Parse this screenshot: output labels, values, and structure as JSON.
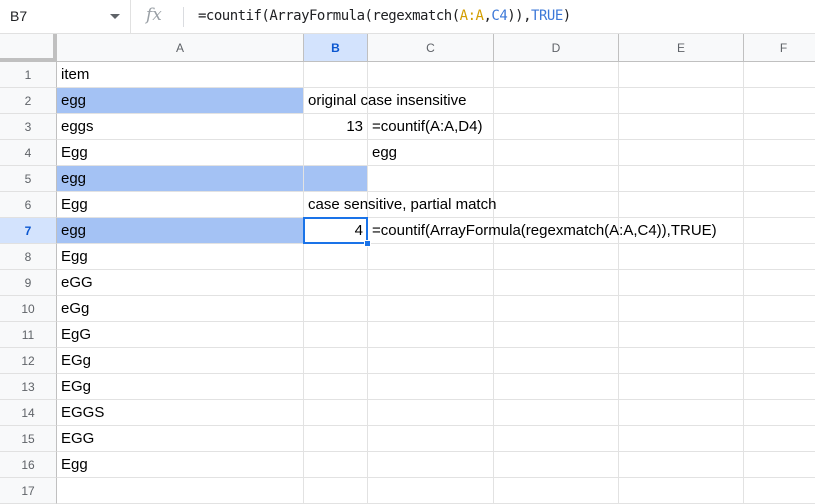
{
  "formula_bar": {
    "name_box": "B7",
    "fx_label": "fx",
    "formula_parts": [
      {
        "text": "=countif(ArrayFormula(regexmatch(",
        "cls": ""
      },
      {
        "text": "A:A",
        "cls": "hl1"
      },
      {
        "text": ",",
        "cls": ""
      },
      {
        "text": "C4",
        "cls": "hl2"
      },
      {
        "text": ")),",
        "cls": ""
      },
      {
        "text": "TRUE",
        "cls": "kw"
      },
      {
        "text": ")",
        "cls": ""
      }
    ]
  },
  "columns": [
    "A",
    "B",
    "C",
    "D",
    "E",
    "F"
  ],
  "selected_cell": "B7",
  "rows": [
    {
      "n": "1",
      "A": "item",
      "B": "",
      "C": ""
    },
    {
      "n": "2",
      "A": "egg",
      "B": "original case insensitive",
      "C": "",
      "hlA": true
    },
    {
      "n": "3",
      "A": "eggs",
      "B": "13",
      "C": "=countif(A:A,D4)",
      "bnum": true
    },
    {
      "n": "4",
      "A": "Egg",
      "B": "",
      "C": "egg"
    },
    {
      "n": "5",
      "A": "egg",
      "B": "",
      "C": "",
      "hlA": true,
      "hlB": true
    },
    {
      "n": "6",
      "A": "Egg",
      "B": "case sensitive, partial match",
      "C": ""
    },
    {
      "n": "7",
      "A": "egg",
      "B": "4",
      "C": "=countif(ArrayFormula(regexmatch(A:A,C4)),TRUE)",
      "hlA": true,
      "bnum": true
    },
    {
      "n": "8",
      "A": "Egg",
      "B": "",
      "C": ""
    },
    {
      "n": "9",
      "A": "eGG",
      "B": "",
      "C": ""
    },
    {
      "n": "10",
      "A": "eGg",
      "B": "",
      "C": ""
    },
    {
      "n": "11",
      "A": "EgG",
      "B": "",
      "C": ""
    },
    {
      "n": "12",
      "A": "EGg",
      "B": "",
      "C": ""
    },
    {
      "n": "13",
      "A": "EGg",
      "B": "",
      "C": ""
    },
    {
      "n": "14",
      "A": "EGGS",
      "B": "",
      "C": ""
    },
    {
      "n": "15",
      "A": "EGG",
      "B": "",
      "C": ""
    },
    {
      "n": "16",
      "A": "Egg",
      "B": "",
      "C": ""
    },
    {
      "n": "17",
      "A": "",
      "B": "",
      "C": ""
    }
  ]
}
